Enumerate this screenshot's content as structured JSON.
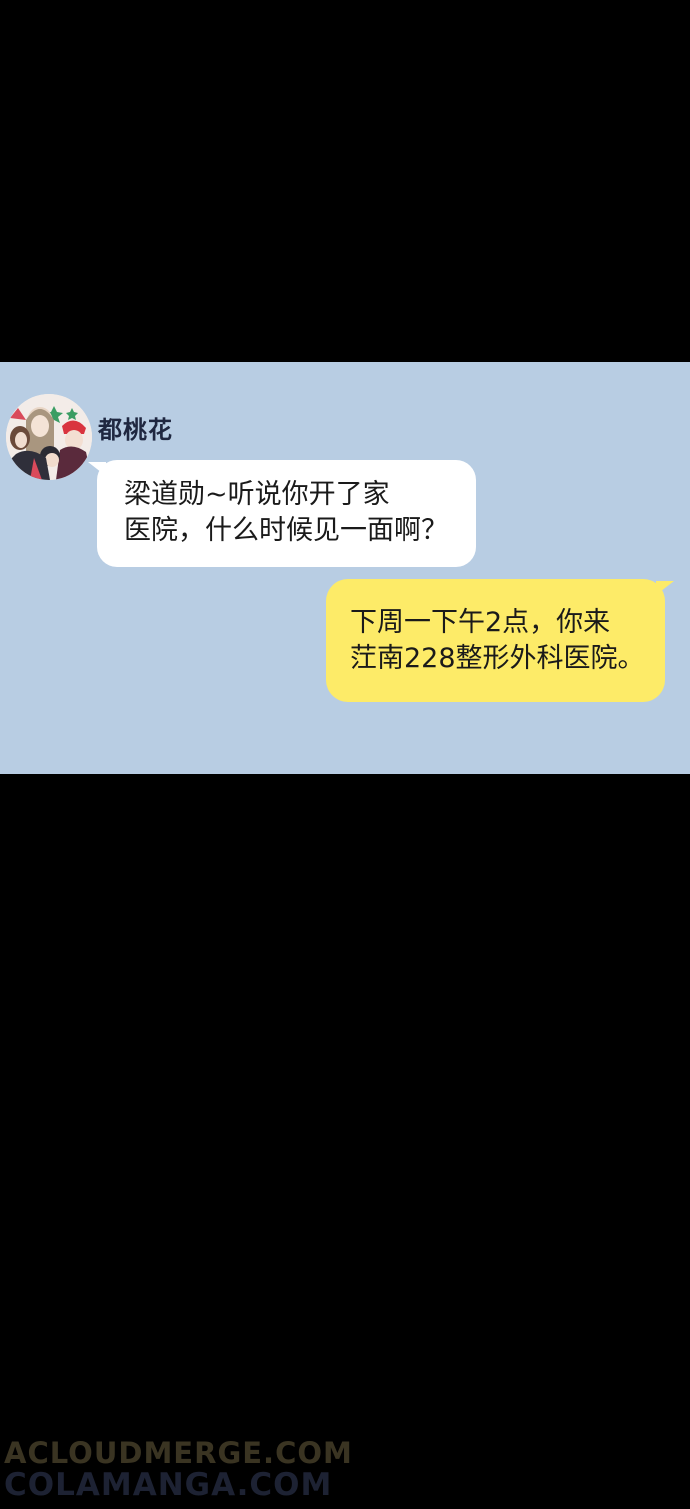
{
  "conversation": {
    "sender": {
      "name": "都桃花",
      "avatar_icon": "group-photo-avatar"
    },
    "messages": [
      {
        "direction": "incoming",
        "lines": [
          "梁道勋~听说你开了家",
          "医院，什么时候见一面啊？"
        ],
        "bubble_color": "#ffffff"
      },
      {
        "direction": "outgoing",
        "lines": [
          "下周一下午2点，你来",
          "茳南228整形外科医院。"
        ],
        "bubble_color": "#fdeb68"
      }
    ],
    "background_color": "#b8cde3"
  },
  "watermark": {
    "line1": "ACLOUDMERGE.COM",
    "line2": "COLAMANGA.COM"
  }
}
